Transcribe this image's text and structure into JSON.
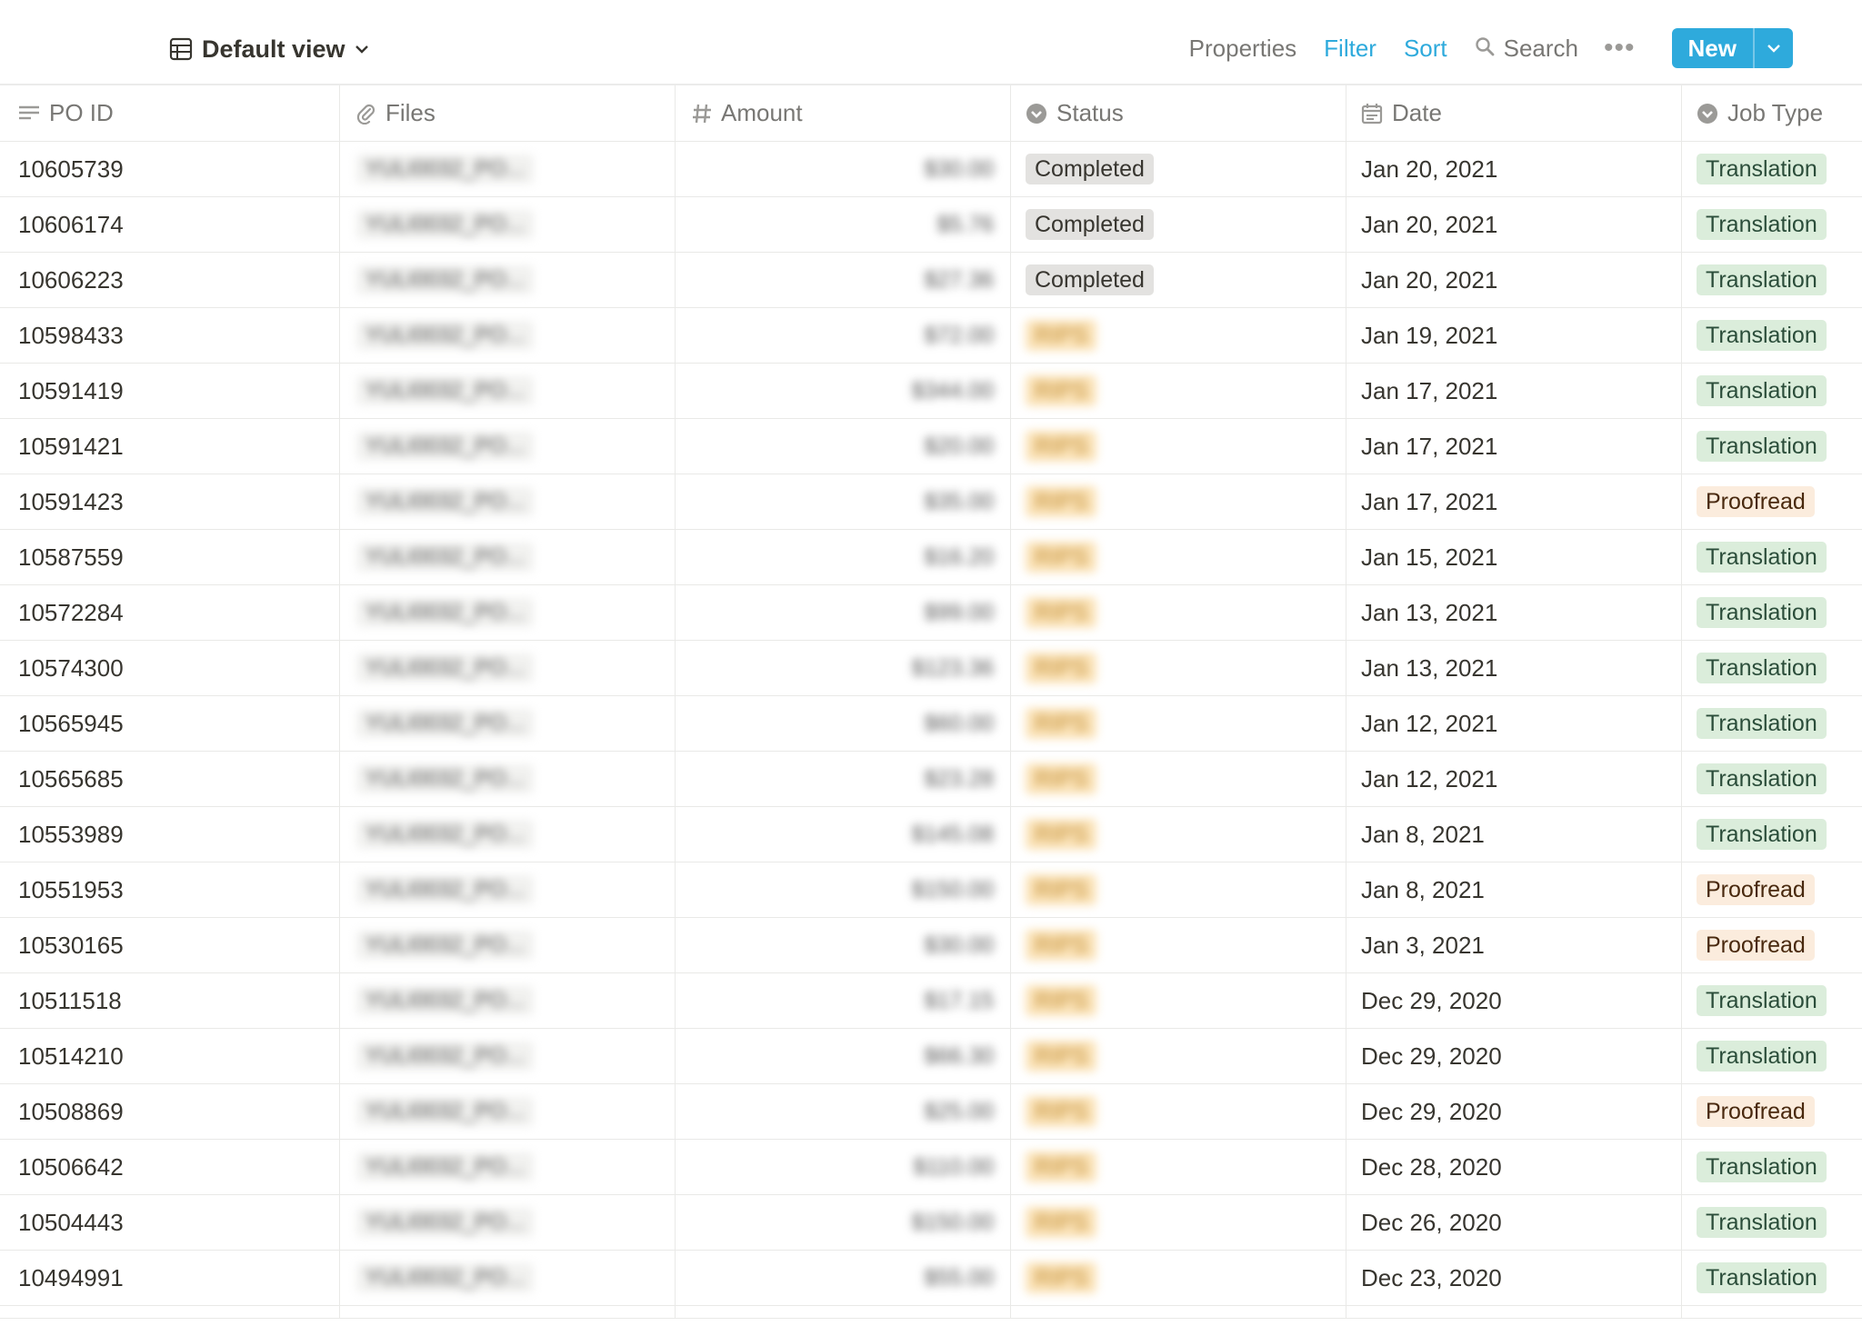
{
  "toolbar": {
    "view_label": "Default view",
    "properties_label": "Properties",
    "filter_label": "Filter",
    "sort_label": "Sort",
    "search_label": "Search",
    "more_label": "•••",
    "new_label": "New",
    "accent_color": "#2eaadc"
  },
  "table": {
    "columns": [
      {
        "label": "PO ID",
        "icon": "text-lines-icon"
      },
      {
        "label": "Files",
        "icon": "paperclip-icon"
      },
      {
        "label": "Amount",
        "icon": "hash-icon"
      },
      {
        "label": "Status",
        "icon": "select-circle-icon"
      },
      {
        "label": "Date",
        "icon": "calendar-icon"
      },
      {
        "label": "Job Type",
        "icon": "select-circle-icon"
      }
    ],
    "rows": [
      {
        "po": "10605739",
        "files": "YULI0032_PO...",
        "amount": "$30.00",
        "status": "Completed",
        "date": "Jan 20, 2021",
        "job": "Translation"
      },
      {
        "po": "10606174",
        "files": "YULI0032_PO...",
        "amount": "$5.76",
        "status": "Completed",
        "date": "Jan 20, 2021",
        "job": "Translation"
      },
      {
        "po": "10606223",
        "files": "YULI0032_PO...",
        "amount": "$27.36",
        "status": "Completed",
        "date": "Jan 20, 2021",
        "job": "Translation"
      },
      {
        "po": "10598433",
        "files": "YULI0032_PO...",
        "amount": "$72.00",
        "status": "RIPS",
        "date": "Jan 19, 2021",
        "job": "Translation"
      },
      {
        "po": "10591419",
        "files": "YULI0032_PO...",
        "amount": "$344.00",
        "status": "RIPS",
        "date": "Jan 17, 2021",
        "job": "Translation"
      },
      {
        "po": "10591421",
        "files": "YULI0032_PO...",
        "amount": "$20.00",
        "status": "RIPS",
        "date": "Jan 17, 2021",
        "job": "Translation"
      },
      {
        "po": "10591423",
        "files": "YULI0032_PO...",
        "amount": "$35.00",
        "status": "RIPS",
        "date": "Jan 17, 2021",
        "job": "Proofread"
      },
      {
        "po": "10587559",
        "files": "YULI0032_PO...",
        "amount": "$16.20",
        "status": "RIPS",
        "date": "Jan 15, 2021",
        "job": "Translation"
      },
      {
        "po": "10572284",
        "files": "YULI0032_PO...",
        "amount": "$99.00",
        "status": "RIPS",
        "date": "Jan 13, 2021",
        "job": "Translation"
      },
      {
        "po": "10574300",
        "files": "YULI0032_PO...",
        "amount": "$123.36",
        "status": "RIPS",
        "date": "Jan 13, 2021",
        "job": "Translation"
      },
      {
        "po": "10565945",
        "files": "YULI0032_PO...",
        "amount": "$60.00",
        "status": "RIPS",
        "date": "Jan 12, 2021",
        "job": "Translation"
      },
      {
        "po": "10565685",
        "files": "YULI0032_PO...",
        "amount": "$23.28",
        "status": "RIPS",
        "date": "Jan 12, 2021",
        "job": "Translation"
      },
      {
        "po": "10553989",
        "files": "YULI0032_PO...",
        "amount": "$145.08",
        "status": "RIPS",
        "date": "Jan 8, 2021",
        "job": "Translation"
      },
      {
        "po": "10551953",
        "files": "YULI0032_PO...",
        "amount": "$150.00",
        "status": "RIPS",
        "date": "Jan 8, 2021",
        "job": "Proofread"
      },
      {
        "po": "10530165",
        "files": "YULI0032_PO...",
        "amount": "$30.00",
        "status": "RIPS",
        "date": "Jan 3, 2021",
        "job": "Proofread"
      },
      {
        "po": "10511518",
        "files": "YULI0032_PO...",
        "amount": "$17.15",
        "status": "RIPS",
        "date": "Dec 29, 2020",
        "job": "Translation"
      },
      {
        "po": "10514210",
        "files": "YULI0032_PO...",
        "amount": "$66.30",
        "status": "RIPS",
        "date": "Dec 29, 2020",
        "job": "Translation"
      },
      {
        "po": "10508869",
        "files": "YULI0032_PO...",
        "amount": "$25.00",
        "status": "RIPS",
        "date": "Dec 29, 2020",
        "job": "Proofread"
      },
      {
        "po": "10506642",
        "files": "YULI0032_PO...",
        "amount": "$110.00",
        "status": "RIPS",
        "date": "Dec 28, 2020",
        "job": "Translation"
      },
      {
        "po": "10504443",
        "files": "YULI0032_PO...",
        "amount": "$150.00",
        "status": "RIPS",
        "date": "Dec 26, 2020",
        "job": "Translation"
      },
      {
        "po": "10494991",
        "files": "YULI0032_PO...",
        "amount": "$55.00",
        "status": "RIPS",
        "date": "Dec 23, 2020",
        "job": "Translation"
      }
    ]
  }
}
